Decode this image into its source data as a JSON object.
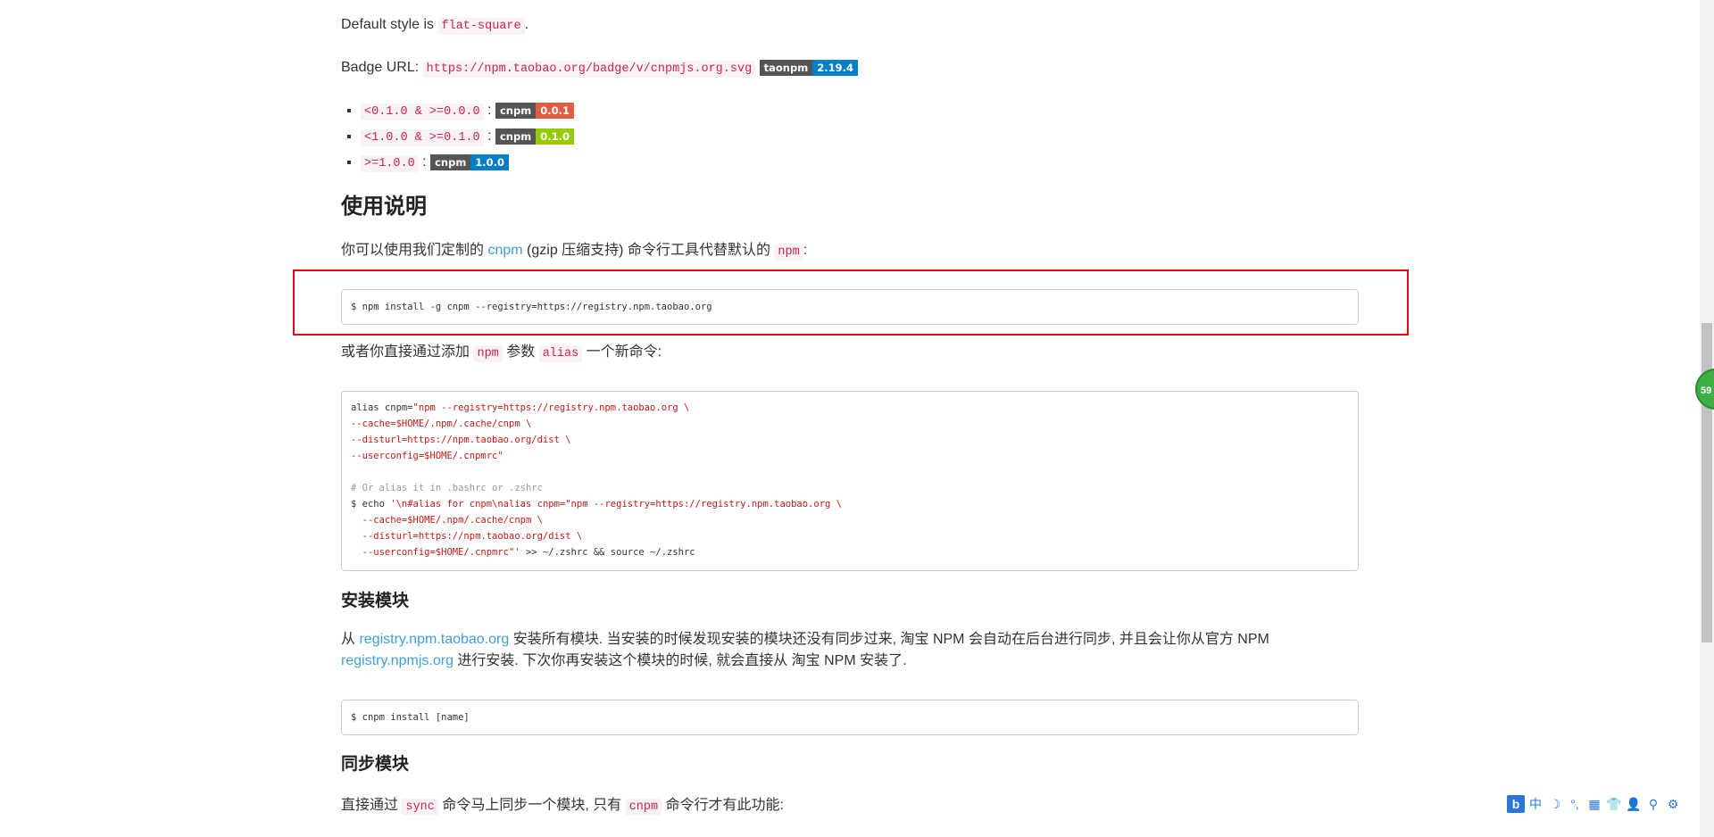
{
  "style_note": {
    "prefix": "Default style is",
    "code": "flat-square",
    "suffix": "."
  },
  "badge_url": {
    "label": "Badge URL:",
    "code": "https://npm.taobao.org/badge/v/cnpmjs.org.svg",
    "badge": {
      "left": "taonpm",
      "right": "2.19.4",
      "color": "#007ec6"
    }
  },
  "versions": [
    {
      "code": "<0.1.0 & >=0.0.0",
      "sep": ":",
      "badge_left": "cnpm",
      "badge_right": "0.0.1",
      "color": "#e05d44"
    },
    {
      "code": "<1.0.0 & >=0.1.0",
      "sep": ":",
      "badge_left": "cnpm",
      "badge_right": "0.1.0",
      "color": "#97ca00"
    },
    {
      "code": ">=1.0.0",
      "sep": ":",
      "badge_left": "cnpm",
      "badge_right": "1.0.0",
      "color": "#007ec6"
    }
  ],
  "usage": {
    "title": "使用说明",
    "intro_pre": "你可以使用我们定制的",
    "intro_link": "cnpm",
    "intro_mid": "(gzip 压缩支持) 命令行工具代替默认的",
    "intro_code": "npm",
    "intro_post": ":",
    "install_cmd": "$ npm install -g cnpm --registry=https://registry.npm.taobao.org",
    "alias_pre": "或者你直接通过添加",
    "alias_code1": "npm",
    "alias_mid": "参数",
    "alias_code2": "alias",
    "alias_post": "一个新命令:"
  },
  "alias_block": {
    "lines": [
      [
        "alias cnpm=",
        "\"npm --registry=https://registry.npm.taobao.org \\"
      ],
      [
        "",
        "--cache=$HOME/.npm/.cache/cnpm \\"
      ],
      [
        "",
        "--disturl=https://npm.taobao.org/dist \\"
      ],
      [
        "",
        "--userconfig=$HOME/.cnpmrc\""
      ],
      [
        "",
        ""
      ],
      [
        "#",
        "# Or alias it in .bashrc or .zshrc"
      ],
      [
        "$ echo ",
        "'\\n#alias for cnpm\\nalias cnpm=\"npm --registry=https://registry.npm.taobao.org \\"
      ],
      [
        "",
        "  --cache=$HOME/.npm/.cache/cnpm \\"
      ],
      [
        "",
        "  --disturl=https://npm.taobao.org/dist \\"
      ],
      [
        "tail",
        "  --userconfig=$HOME/.cnpmrc\"'",
        " >> ~/.zshrc && source ~/.zshrc"
      ]
    ]
  },
  "install_module": {
    "title": "安装模块",
    "p1_pre": "从",
    "p1_link": "registry.npm.taobao.org",
    "p1_post": "安装所有模块. 当安装的时候发现安装的模块还没有同步过来, 淘宝 NPM 会自动在后台进行同步, 并且会让你从官方 NPM",
    "p2_link": "registry.npmjs.org",
    "p2_post": "进行安装. 下次你再安装这个模块的时候, 就会直接从 淘宝 NPM 安装了.",
    "cmd": "$ cnpm install [name]"
  },
  "sync_module": {
    "title": "同步模块",
    "p_pre": "直接通过",
    "p_code1": "sync",
    "p_mid": "命令马上同步一个模块, 只有",
    "p_code2": "cnpm",
    "p_post": "命令行才有此功能:"
  },
  "float_bubble": {
    "text": "59"
  },
  "ime_toolbar": {
    "logo": "b",
    "items": [
      "中",
      "☽",
      "°,",
      "▦",
      "👕",
      "👤",
      "⚲",
      "⚙"
    ],
    "icons": [
      "ime-logo-icon",
      "chinese-mode-icon",
      "moon-icon",
      "punctuation-icon",
      "keyboard-icon",
      "skin-icon",
      "user-icon",
      "search-icon",
      "gear-icon"
    ]
  },
  "colors": {
    "link": "#3f9fd6",
    "code": "#c7254e",
    "highlight_box": "#e60012"
  }
}
